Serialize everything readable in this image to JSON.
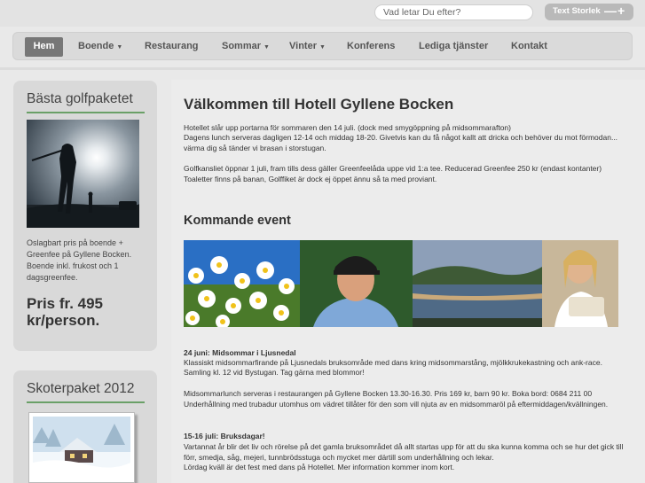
{
  "search": {
    "placeholder": "Vad letar Du efter?"
  },
  "textsize": {
    "label": "Text Storlek",
    "minus": "—",
    "plus": "+"
  },
  "nav": [
    {
      "label": "Hem",
      "active": true
    },
    {
      "label": "Boende",
      "caret": true
    },
    {
      "label": "Restaurang"
    },
    {
      "label": "Sommar",
      "caret": true
    },
    {
      "label": "Vinter",
      "caret": true
    },
    {
      "label": "Konferens"
    },
    {
      "label": "Lediga tjänster"
    },
    {
      "label": "Kontakt"
    }
  ],
  "caret_glyph": "▼",
  "sidebar": {
    "box1": {
      "title": "Bästa golfpaketet",
      "text": "Oslagbart pris på boende + Greenfee på Gyllene Bocken. Boende inkl. frukost och 1 dagsgreenfee.",
      "price": "Pris fr. 495 kr/person."
    },
    "box2": {
      "title": "Skoterpaket 2012"
    }
  },
  "main": {
    "title": "Välkommen till Hotell Gyllene Bocken",
    "p1": "Hotellet slår upp portarna för sommaren den 14 juli. (dock med smygöppning på midsommarafton)",
    "p2": "Dagens lunch serveras dagligen 12-14 och middag 18-20.  Givetvis kan du få något kallt att dricka och behöver du mot förmodan... värma dig så tänder vi brasan i storstugan.",
    "p3": "Golfkansliet öppnar 1 juli, fram tills dess gäller Greenfeelåda uppe vid 1:a tee. Reducerad Greenfee 250 kr (endast kontanter)",
    "p4": "Toaletter finns på banan, Golffiket är dock ej öppet ännu så ta med proviant.",
    "events_heading": "Kommande event",
    "e1_title": "24 juni: Midsommar i Ljusnedal",
    "e1_l1": "Klassiskt midsommarfirande på Ljusnedals bruksområde med dans kring midsommarstång, mjölkkrukekastning och ank-race.",
    "e1_l2": "Samling kl. 12 vid Bystugan. Tag gärna med blommor!",
    "e2_l1": "Midsommarlunch serveras i restaurangen på Gyllene Bocken 13.30-16.30. Pris 169 kr, barn 90 kr. Boka bord: 0684 211 00",
    "e2_l2": "Underhållning med trubadur utomhus om vädret tillåter för den som vill njuta av en midsommaröl på eftermiddagen/kvällningen.",
    "e3_title": "15-16 juli: Bruksdagar!",
    "e3_l1": "Vartannat år blir det liv och rörelse på det gamla bruksområdet då allt startas upp för att du ska kunna komma och se hur det gick till förr, smedja, såg, mejeri, tunnbrödsstuga och mycket mer därtill som underhållning och lekar.",
    "e3_l2": "Lördag kväll är det fest med dans på Hotellet. Mer information kommer inom kort."
  }
}
